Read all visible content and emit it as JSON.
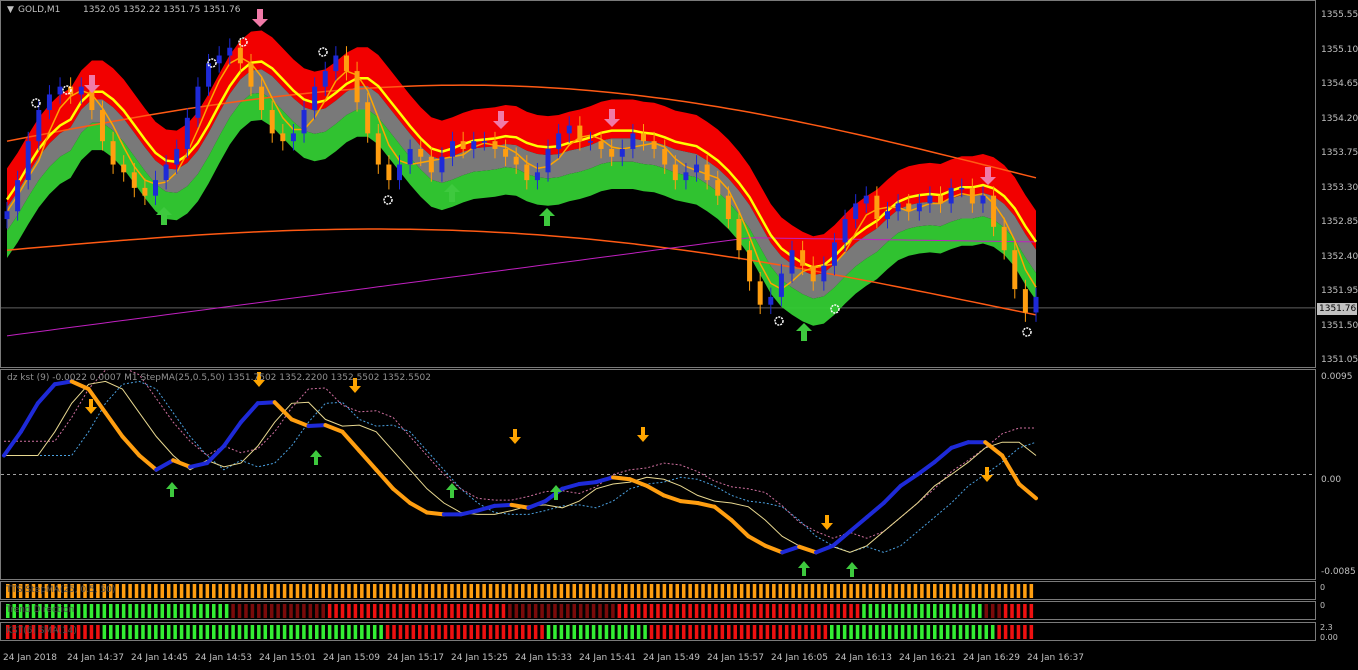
{
  "chart_header": {
    "symbol": "GOLD,M1",
    "ohlc": "1352.05 1352.22 1351.75 1351.76",
    "dropdown_glyph": "▼"
  },
  "osc_header": "dz kst (9) -0.0022 0.0007 M1 StepMA(25,0.5,50) 1351.7502 1352.2200 1352.5502 1352.5502",
  "strip_labels": [
    "TTS StepMA(25, 0.5, 50)",
    "Trend Direction",
    "KST(6) SMA(14)"
  ],
  "price_axis": [
    "1355.55",
    "1355.10",
    "1354.65",
    "1354.20",
    "1353.75",
    "1353.30",
    "1352.85",
    "1352.40",
    "1351.95",
    "1351.50",
    "1351.05"
  ],
  "current_price": "1351.76",
  "osc_axis": [
    "0.0095",
    "0.00",
    "-0.0085"
  ],
  "strip_axis": [
    "0",
    "0",
    "2.3",
    "0.00"
  ],
  "time_axis": [
    "24 Jan 2018",
    "24 Jan 14:37",
    "24 Jan 14:45",
    "24 Jan 14:53",
    "24 Jan 15:01",
    "24 Jan 15:09",
    "24 Jan 15:17",
    "24 Jan 15:25",
    "24 Jan 15:33",
    "24 Jan 15:41",
    "24 Jan 15:49",
    "24 Jan 15:57",
    "24 Jan 16:05",
    "24 Jan 16:13",
    "24 Jan 16:21",
    "24 Jan 16:29",
    "24 Jan 16:37"
  ],
  "colors": {
    "bull": "#1e2ad8",
    "bear": "#ff9e10",
    "up_arrow": "#3ec93e",
    "down_arrow": "#f07aa8",
    "cloud_red": "#ff0000",
    "cloud_green": "#33cc33",
    "cloud_gray": "#808080",
    "yellow": "#ffff00",
    "orange_line": "#ff5a14",
    "magenta": "#c020c0",
    "cyan": "#30d8ff"
  },
  "chart_data": {
    "type": "candlestick",
    "ylim": [
      1351.0,
      1355.7
    ],
    "closes": [
      1353.0,
      1353.4,
      1353.9,
      1354.3,
      1354.5,
      1354.6,
      1354.5,
      1354.6,
      1354.3,
      1353.9,
      1353.6,
      1353.5,
      1353.3,
      1353.2,
      1353.4,
      1353.6,
      1353.8,
      1354.2,
      1354.6,
      1354.9,
      1355.0,
      1355.1,
      1354.9,
      1354.6,
      1354.3,
      1354.0,
      1353.9,
      1354.0,
      1354.3,
      1354.6,
      1354.8,
      1355.0,
      1354.8,
      1354.4,
      1354.0,
      1353.6,
      1353.4,
      1353.6,
      1353.8,
      1353.7,
      1353.5,
      1353.7,
      1353.9,
      1353.8,
      1353.9,
      1353.9,
      1353.8,
      1353.7,
      1353.6,
      1353.4,
      1353.5,
      1353.8,
      1354.0,
      1354.1,
      1353.9,
      1353.9,
      1353.8,
      1353.7,
      1353.8,
      1354.0,
      1353.9,
      1353.8,
      1353.6,
      1353.4,
      1353.5,
      1353.6,
      1353.4,
      1353.2,
      1352.9,
      1352.5,
      1352.1,
      1351.8,
      1351.9,
      1352.2,
      1352.5,
      1352.3,
      1352.1,
      1352.3,
      1352.6,
      1352.9,
      1353.1,
      1353.2,
      1352.9,
      1353.0,
      1353.1,
      1353.0,
      1353.1,
      1353.2,
      1353.1,
      1353.3,
      1353.3,
      1353.1,
      1353.2,
      1352.8,
      1352.5,
      1352.0,
      1351.7,
      1351.9
    ]
  },
  "osc_data": {
    "ylim": [
      -0.011,
      0.011
    ],
    "kst": [
      0.002,
      0.0045,
      0.0075,
      0.0095,
      0.0098,
      0.009,
      0.0065,
      0.004,
      0.002,
      0.0005,
      0.0015,
      0.0008,
      0.0012,
      0.003,
      0.0055,
      0.0075,
      0.0076,
      0.0058,
      0.0051,
      0.0052,
      0.0045,
      0.0025,
      0.0005,
      -0.0015,
      -0.003,
      -0.004,
      -0.0042,
      -0.0042,
      -0.0038,
      -0.0033,
      -0.0032,
      -0.0035,
      -0.0028,
      -0.0015,
      -0.001,
      -0.0008,
      -0.0003,
      -0.0005,
      -0.0012,
      -0.0022,
      -0.0028,
      -0.003,
      -0.0034,
      -0.0048,
      -0.0065,
      -0.0075,
      -0.0082,
      -0.0076,
      -0.0082,
      -0.0075,
      -0.006,
      -0.0045,
      -0.003,
      -0.0012,
      0.0,
      0.0013,
      0.0028,
      0.0034,
      0.0034,
      0.002,
      -0.001,
      -0.0025
    ]
  },
  "strips": {
    "strip1_colors": "oooooooooooooooooooooooooooooooooooooooooooooooooooooooooooooooooooooooooooooooooooooooooooooooooooooooooooooooooooooooooooooooooooooooooooooooooooooooooooooooooooo",
    "strip2_colors": "gggggggggggggggggggggggggggggggggggggggggddddddddddddddddddrrrrrrrrrrrrrrrrrrrrrrrrrrrrrrrrrrddddddddddddddddddddrrrrrrrrrrrrrrrrrrrrrrrrrrrrrrrrrrrrrrrrrrrrrgggggggggggggggggggggggdddrrrrrrr",
    "strip3_colors": "rrrrrrrrrrrrrrrrrrgggggggggggggggggggggggggggggggggggggggggggggggggggggggrrrrrrrrrrrrrrrrrrrrrrrrrrrrrrrrggggggggggggggggggggrrrrrrrrrrrrrrrrrrrrrrrrrrrrrrrrrrrggggggggggggggggggggggggggggggggrrrrrrrr"
  }
}
